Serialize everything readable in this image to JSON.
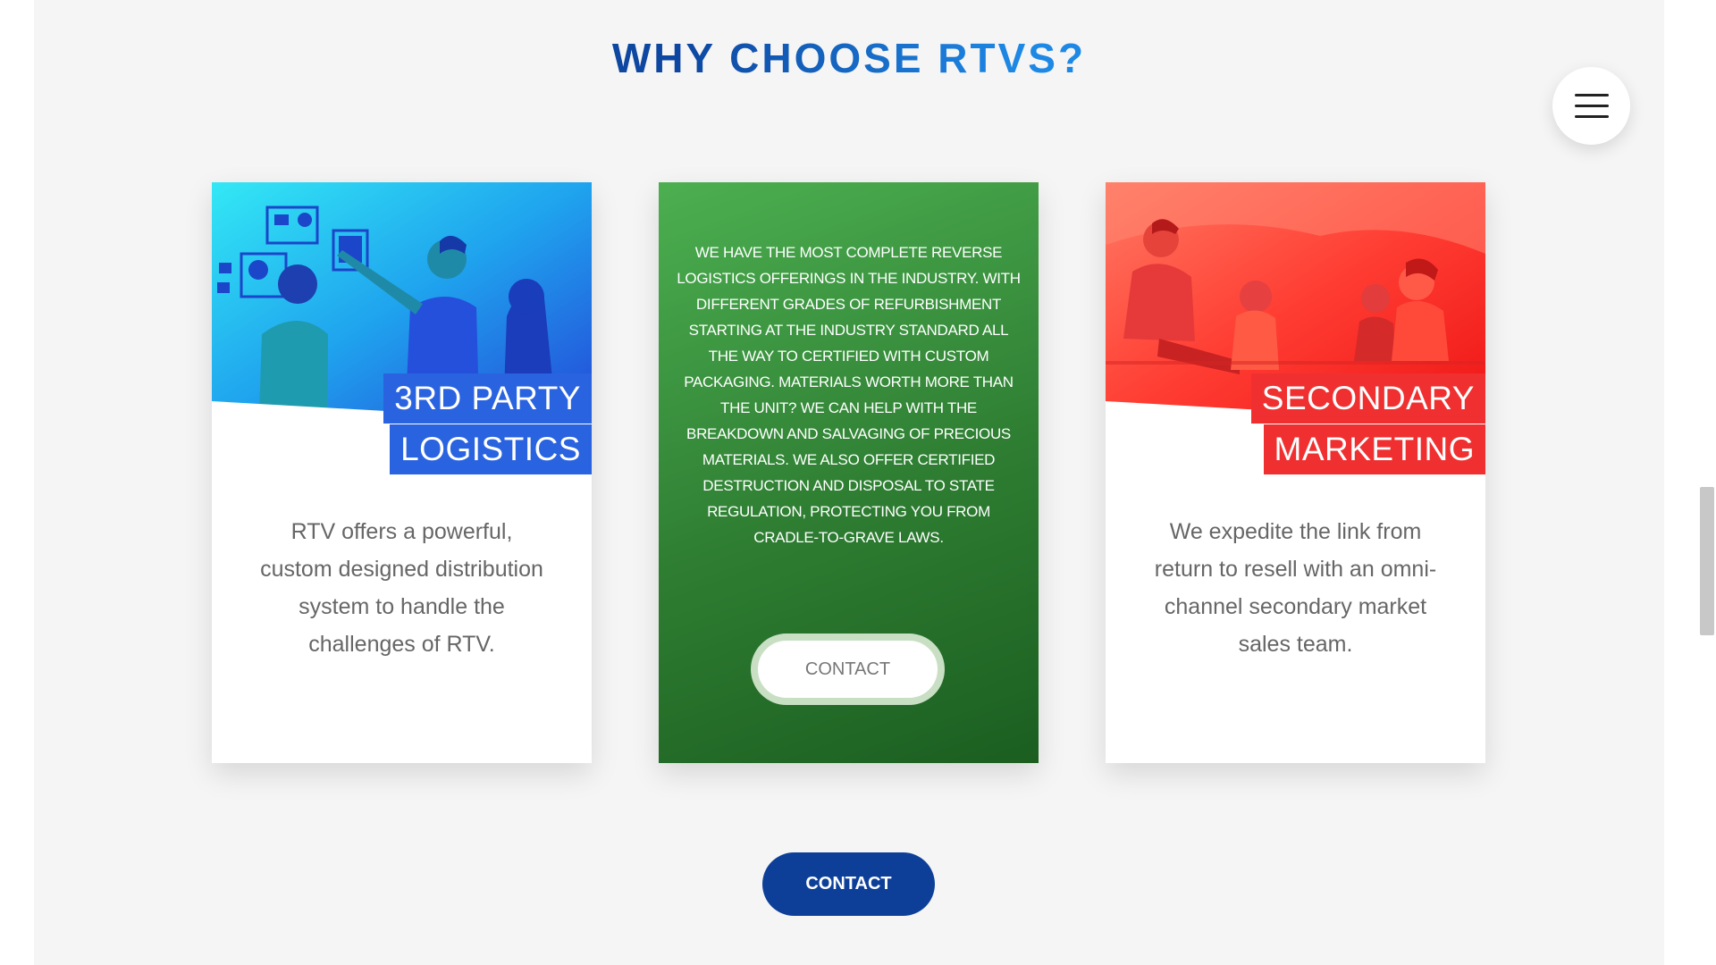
{
  "section": {
    "title": "WHY CHOOSE RTVS?"
  },
  "cards": [
    {
      "tag_line1": "3RD PARTY",
      "tag_line2": "LOGISTICS",
      "body": "RTV offers a powerful, custom designed distribution system to handle the challenges of RTV."
    },
    {
      "body": "WE HAVE THE MOST COMPLETE REVERSE LOGISTICS OFFERINGS IN THE INDUSTRY. WITH DIFFERENT GRADES OF REFURBISHMENT STARTING AT THE INDUSTRY STANDARD ALL THE WAY TO CERTIFIED WITH CUSTOM PACKAGING. MATERIALS WORTH MORE THAN THE UNIT? WE CAN HELP WITH THE BREAKDOWN AND SALVAGING OF PRECIOUS MATERIALS. WE ALSO OFFER CERTIFIED DESTRUCTION AND DISPOSAL TO STATE REGULATION, PROTECTING YOU FROM CRADLE-TO-GRAVE LAWS.",
      "button_label": "CONTACT"
    },
    {
      "tag_line1": "SECONDARY",
      "tag_line2": "MARKETING",
      "body": "We expedite the link from return to resell with an omni-channel secondary market sales team."
    }
  ],
  "contact_button": {
    "label": "CONTACT"
  },
  "menu": {
    "icon": "hamburger-menu-icon"
  },
  "colors": {
    "heading_dark": "#0d47a1",
    "heading_light": "#1e88e5",
    "card1_tag": "#2a63e0",
    "card2_bg": "#2e7d32",
    "card3_tag": "#f03030",
    "contact_bg": "#0d3f99"
  }
}
